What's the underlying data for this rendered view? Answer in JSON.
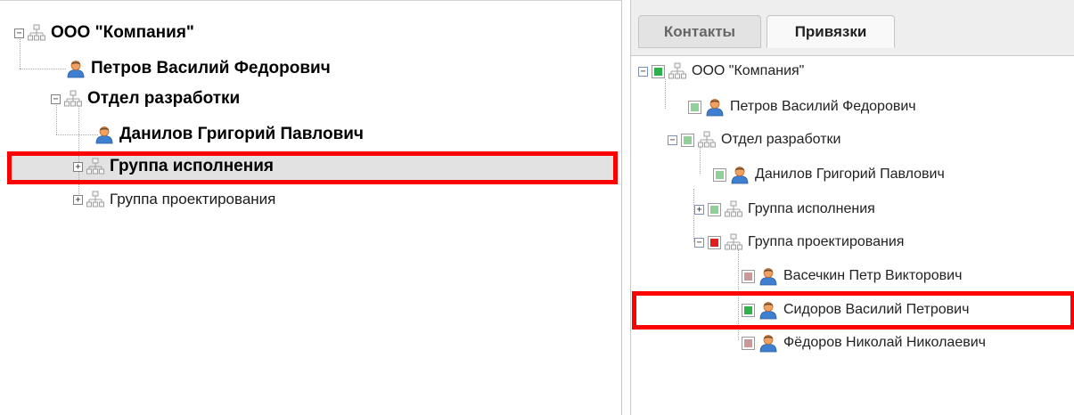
{
  "left_tree": {
    "root": {
      "label": "ООО \"Компания\"",
      "icon": "org-icon"
    },
    "items": [
      {
        "label": "Петров Василий Федорович",
        "icon": "person-icon"
      },
      {
        "label": "Отдел разработки",
        "icon": "org-icon"
      },
      {
        "label": "Данилов Григорий Павлович",
        "icon": "person-icon"
      },
      {
        "label": "Группа исполнения",
        "icon": "org-icon",
        "selected": true
      },
      {
        "label": "Группа проектирования",
        "icon": "org-icon"
      }
    ]
  },
  "tabs": [
    {
      "label": "Контакты",
      "active": false
    },
    {
      "label": "Привязки",
      "active": true
    }
  ],
  "right_tree": {
    "items": [
      {
        "label": "ООО \"Компания\"",
        "icon": "org-icon",
        "check": "green"
      },
      {
        "label": "Петров Василий Федорович",
        "icon": "person-icon",
        "check": "green-light"
      },
      {
        "label": "Отдел разработки",
        "icon": "org-icon",
        "check": "green-light"
      },
      {
        "label": "Данилов Григорий Павлович",
        "icon": "person-icon",
        "check": "green-light"
      },
      {
        "label": "Группа исполнения",
        "icon": "org-icon",
        "check": "green-light"
      },
      {
        "label": "Группа проектирования",
        "icon": "org-icon",
        "check": "red"
      },
      {
        "label": "Васечкин Петр Викторович",
        "icon": "person-icon",
        "check": "red-light"
      },
      {
        "label": "Сидоров Василий Петрович",
        "icon": "person-icon",
        "check": "green"
      },
      {
        "label": "Фёдоров Николай Николаевич",
        "icon": "person-icon",
        "check": "red-light"
      }
    ]
  },
  "colors": {
    "highlight": "#ff0000",
    "selection": "#e2e2e2",
    "check_green": "#2eb04a",
    "check_green_light": "#8fcf98",
    "check_red": "#e01e1e",
    "check_red_light": "#c99999"
  }
}
